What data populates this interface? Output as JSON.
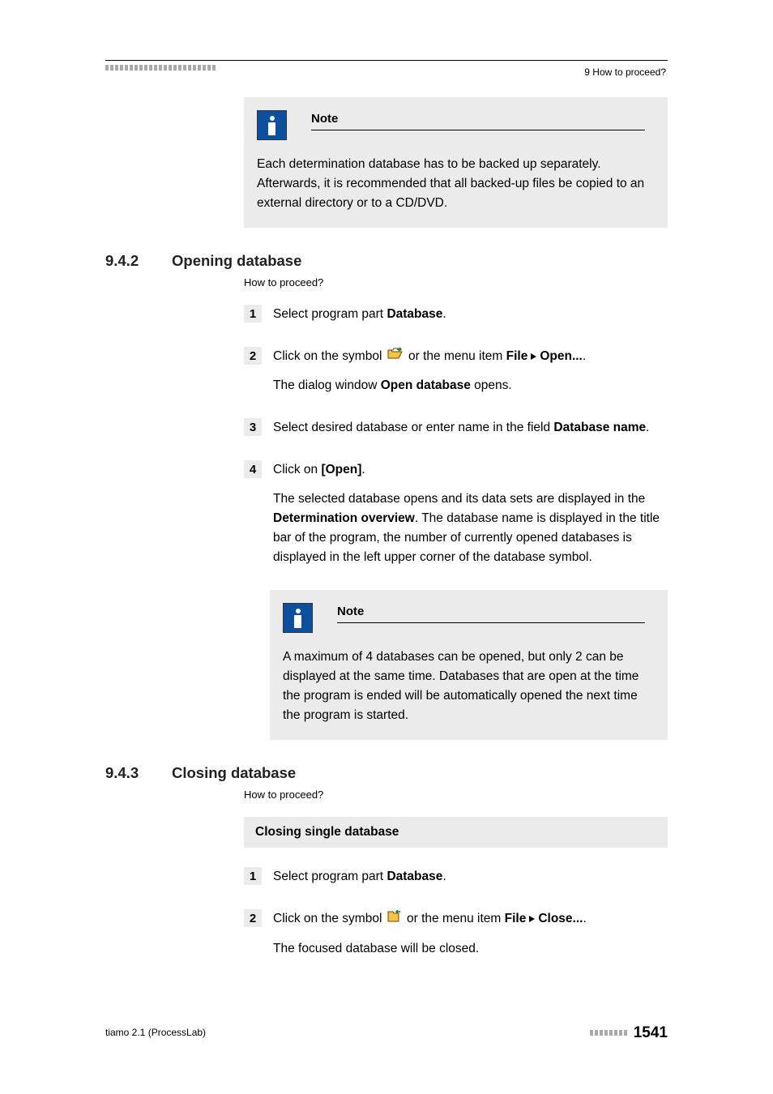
{
  "header": {
    "breadcrumb": "9 How to proceed?"
  },
  "note1": {
    "title": "Note",
    "body": "Each determination database has to be backed up separately. Afterwards, it is recommended that all backed-up files be copied to an external directory or to a CD/DVD."
  },
  "section942": {
    "num": "9.4.2",
    "title": "Opening database",
    "howto": "How to proceed?",
    "steps": {
      "s1": {
        "num": "1",
        "text_a": "Select program part ",
        "text_b": "Database",
        "text_c": "."
      },
      "s2": {
        "num": "2",
        "line1_a": "Click on the symbol ",
        "line1_b": " or the menu item ",
        "line1_file": "File",
        "line1_open": "Open...",
        "line1_end": ".",
        "line2_a": "The dialog window ",
        "line2_b": "Open database",
        "line2_c": " opens."
      },
      "s3": {
        "num": "3",
        "text_a": "Select desired database or enter name in the field ",
        "text_b": "Database name",
        "text_c": "."
      },
      "s4": {
        "num": "4",
        "line1_a": "Click on ",
        "line1_b": "[Open]",
        "line1_c": ".",
        "para_a": "The selected database opens and its data sets are displayed in the ",
        "para_b": "Determination overview",
        "para_c": ". The database name is displayed in the title bar of the program, the number of currently opened databases is displayed in the left upper corner of the database symbol."
      }
    },
    "note": {
      "title": "Note",
      "body": "A maximum of 4 databases can be opened, but only 2 can be displayed at the same time. Databases that are open at the time the program is ended will be automatically opened the next time the program is started."
    }
  },
  "section943": {
    "num": "9.4.3",
    "title": "Closing database",
    "howto": "How to proceed?",
    "subheading": "Closing single database",
    "steps": {
      "s1": {
        "num": "1",
        "text_a": "Select program part ",
        "text_b": "Database",
        "text_c": "."
      },
      "s2": {
        "num": "2",
        "line1_a": "Click on the symbol ",
        "line1_b": " or the menu item ",
        "line1_file": "File",
        "line1_close": "Close...",
        "line1_end": ".",
        "line2": "The focused database will be closed."
      }
    }
  },
  "footer": {
    "left": "tiamo 2.1 (ProcessLab)",
    "page": "1541"
  }
}
